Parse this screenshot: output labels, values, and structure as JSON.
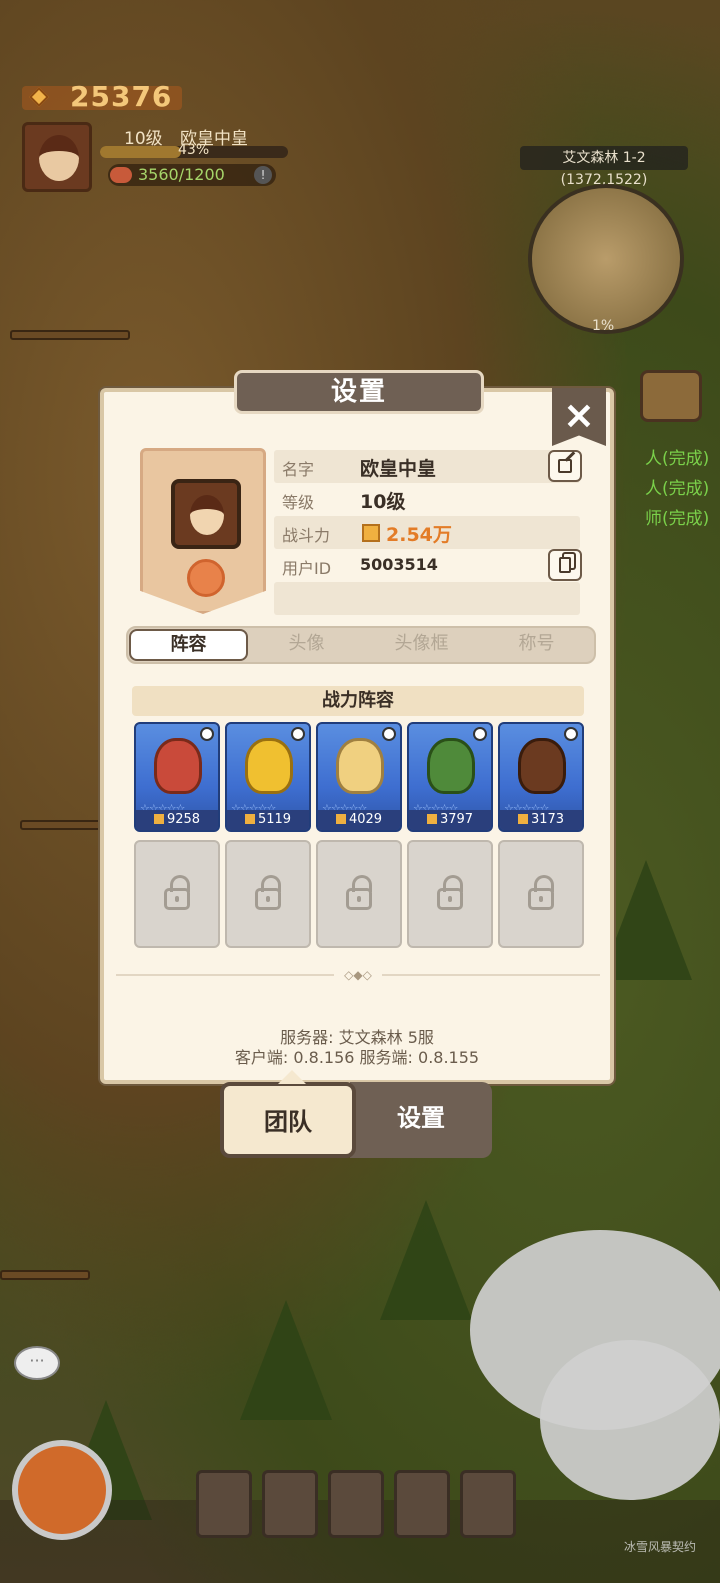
{
  "hud": {
    "gold": "25376",
    "level": "10级",
    "name": "欧皇中皇",
    "xp_percent": "43%",
    "xp_fraction": 0.43,
    "food": "3560/1200",
    "food_info_icon": "!"
  },
  "minimap": {
    "area": "艾文森林 1-2",
    "coords": "(1372,1522)",
    "explore": "1%"
  },
  "quests": [
    "人(完成)",
    "人(完成)",
    "师(完成)"
  ],
  "dialog": {
    "title": "设置",
    "close_label": "✕",
    "profile": {
      "name_label": "名字",
      "name_value": "欧皇中皇",
      "level_label": "等级",
      "level_value": "10级",
      "power_label": "战斗力",
      "power_value": "2.54万",
      "uid_label": "用户ID",
      "uid_value": "5003514"
    },
    "tabs": [
      "阵容",
      "头像",
      "头像框",
      "称号"
    ],
    "lineup_title": "战力阵容",
    "heroes": [
      {
        "power": "9258",
        "stars": "☆☆☆☆☆"
      },
      {
        "power": "5119",
        "stars": "☆☆☆☆☆"
      },
      {
        "power": "4029",
        "stars": "☆☆☆☆☆"
      },
      {
        "power": "3797",
        "stars": "☆☆☆☆☆"
      },
      {
        "power": "3173",
        "stars": "☆☆☆☆☆"
      }
    ],
    "divider_ornament": "◇◆◇",
    "server": "服务器: 艾文森林 5服",
    "version": "客户端: 0.8.156  服务端: 0.8.155"
  },
  "bottom_tabs": {
    "team": "团队",
    "settings": "设置"
  },
  "chat_icon": "···",
  "watermark": "冰雪风暴契约",
  "colors": {
    "hero_card": "#3e6ed0",
    "power_orange": "#e37c27",
    "dialog_bg": "#fbf4e6"
  }
}
